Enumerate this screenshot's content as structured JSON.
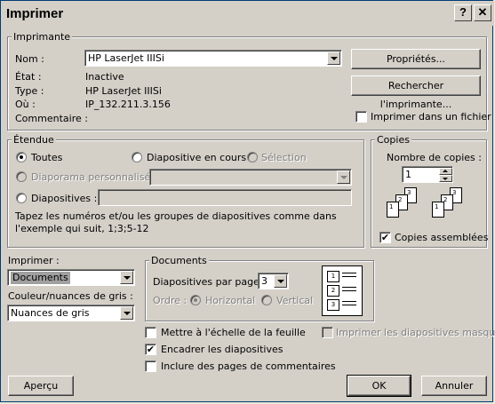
{
  "window": {
    "title": "Imprimer",
    "help_label": "?",
    "close_label": "✕"
  },
  "printer": {
    "legend": "Imprimante",
    "name_label": "Nom :",
    "name_value": "HP LaserJet IIISi",
    "state_label": "État :",
    "state_value": "Inactive",
    "type_label": "Type :",
    "type_value": "HP LaserJet IIISi",
    "where_label": "Où :",
    "where_value": "IP_132.211.3.156",
    "comment_label": "Commentaire :",
    "properties_button": "Propriétés...",
    "find_button": "Rechercher l'imprimante...",
    "print_to_file_label": "Imprimer dans un fichier",
    "print_to_file_checked": false
  },
  "range": {
    "legend": "Étendue",
    "all_label": "Toutes",
    "current_slide_label": "Diapositive en cours",
    "selection_label": "Sélection",
    "custom_show_label": "Diaporama personnalisé :",
    "custom_show_value": "",
    "slides_label": "Diapositives :",
    "slides_value": "",
    "hint": "Tapez les numéros et/ou les groupes de diapositives comme dans l'exemple qui suit, 1;3;5-12",
    "selected": "all"
  },
  "copies": {
    "legend": "Copies",
    "count_label": "Nombre de copies :",
    "count_value": "1",
    "collate_label": "Copies assemblées",
    "collate_checked": true,
    "page_numbers": [
      "1",
      "2",
      "3"
    ]
  },
  "print_what": {
    "label": "Imprimer :",
    "value": "Documents",
    "color_label": "Couleur/nuances de gris :",
    "color_value": "Nuances de gris"
  },
  "handouts": {
    "legend": "Documents",
    "per_page_label": "Diapositives par page :",
    "per_page_value": "3",
    "order_label": "Ordre :",
    "horizontal_label": "Horizontal",
    "vertical_label": "Vertical",
    "preview_numbers": [
      "1",
      "2",
      "3"
    ]
  },
  "options": {
    "scale_label": "Mettre à l'échelle de la feuille",
    "scale_checked": false,
    "frame_label": "Encadrer les diapositives",
    "frame_checked": true,
    "comments_label": "Inclure des pages de commentaires",
    "comments_checked": false,
    "hidden_label": "Imprimer les diapositives masquées",
    "hidden_checked": false
  },
  "buttons": {
    "preview": "Aperçu",
    "ok": "OK",
    "cancel": "Annuler"
  },
  "check_mark": "✔"
}
